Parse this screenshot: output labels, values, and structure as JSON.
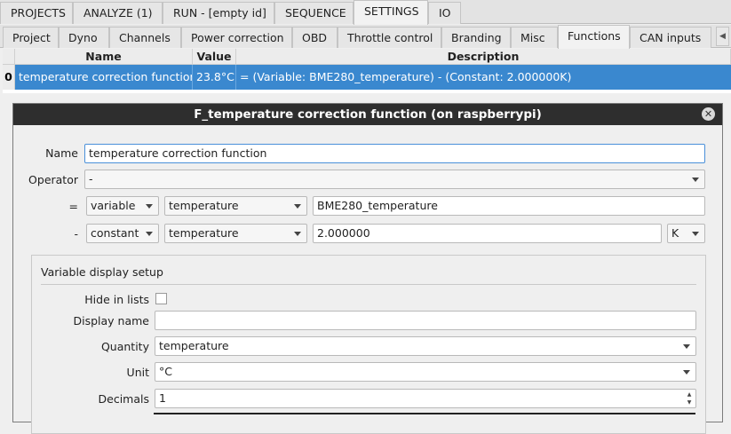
{
  "top_tabs": [
    "PROJECTS",
    "ANALYZE (1)",
    "RUN - [empty id]",
    "SEQUENCE",
    "SETTINGS",
    "IO"
  ],
  "sub_tabs": [
    "Project",
    "Dyno",
    "Channels",
    "Power correction",
    "OBD",
    "Throttle control",
    "Branding",
    "Misc",
    "Functions",
    "CAN inputs"
  ],
  "table": {
    "headers": [
      "Name",
      "Value",
      "Description"
    ],
    "row": {
      "index": "0",
      "name": "temperature correction function",
      "value": "23.8°C",
      "description": "= (Variable: BME280_temperature) - (Constant: 2.000000K)"
    }
  },
  "dialog": {
    "title": "F_temperature correction function (on raspberrypi)",
    "name_label": "Name",
    "name_value": "temperature correction function",
    "operator_label": "Operator",
    "operator_value": "-",
    "row1": {
      "sign": "=",
      "kind": "variable",
      "quantity": "temperature",
      "value": "BME280_temperature"
    },
    "row2": {
      "sign": "-",
      "kind": "constant",
      "quantity": "temperature",
      "value": "2.000000",
      "unit": "K"
    },
    "group": {
      "title": "Variable display setup",
      "hide_label": "Hide in lists",
      "display_name_label": "Display name",
      "display_name_value": "",
      "quantity_label": "Quantity",
      "quantity_value": "temperature",
      "unit_label": "Unit",
      "unit_value": "°C",
      "decimals_label": "Decimals",
      "decimals_value": "1"
    }
  },
  "icons": {
    "close": "close-icon",
    "scroll": "scroll-left-icon"
  }
}
